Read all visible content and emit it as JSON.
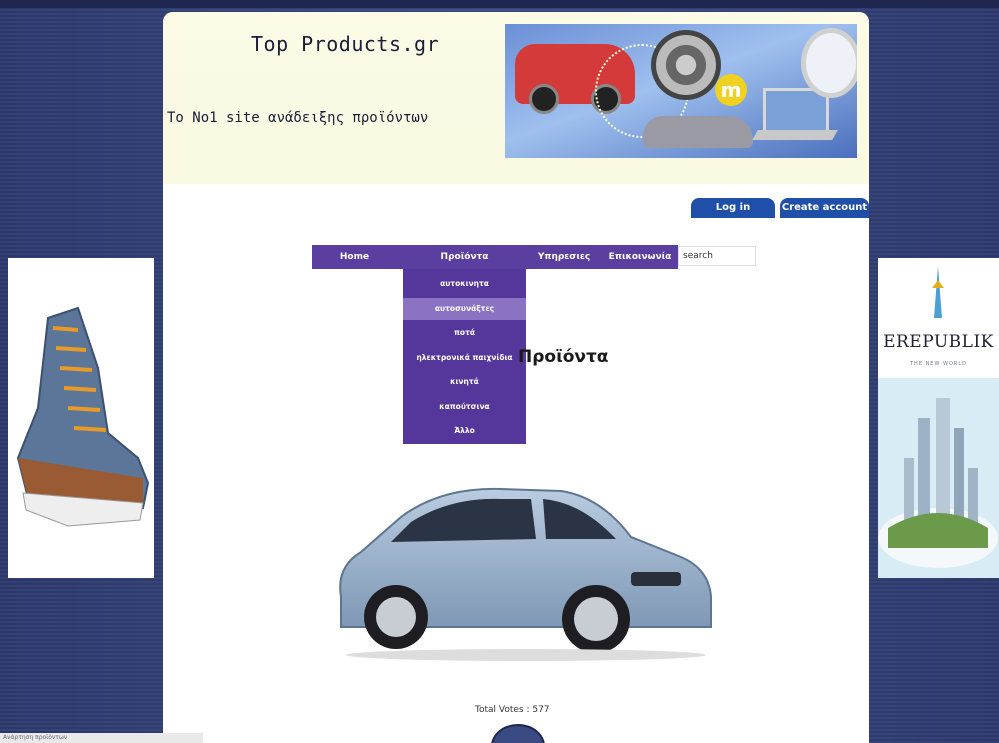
{
  "header": {
    "site_title": "Top Products.gr",
    "subtitle": "Το No1 site ανάδειξης προϊόντων"
  },
  "auth": {
    "login_label": "Log in",
    "create_label": "Create account"
  },
  "nav": {
    "items": [
      {
        "label": "Home"
      },
      {
        "label": "Προϊόντα"
      },
      {
        "label": "Υπηρεσιες"
      },
      {
        "label": "Επικοινωνία"
      }
    ],
    "search_value": "search"
  },
  "dropdown": {
    "items": [
      {
        "label": "αυτοκινητα"
      },
      {
        "label": "αυτοσυνάξτες"
      },
      {
        "label": "ποτά"
      },
      {
        "label": "ηλεκτρονικά παιχνίδια"
      },
      {
        "label": "κινητά"
      },
      {
        "label": "καπούτσινα"
      },
      {
        "label": "Άλλο"
      }
    ],
    "highlighted_index": 1
  },
  "main": {
    "section_title": "Προϊόντα",
    "votes_label": "Total Votes : 577"
  },
  "ads": {
    "right_brand": "EREPUBLIK",
    "right_tagline": "THE NEW WORLD"
  },
  "footer": {
    "status_text": "Ανάρτηση προϊόντων"
  },
  "colors": {
    "nav_bg": "#5a3fa0",
    "dropdown_bg": "#55379b",
    "button_bg": "#1f4fa8",
    "page_bg": "#2e3a6e"
  }
}
